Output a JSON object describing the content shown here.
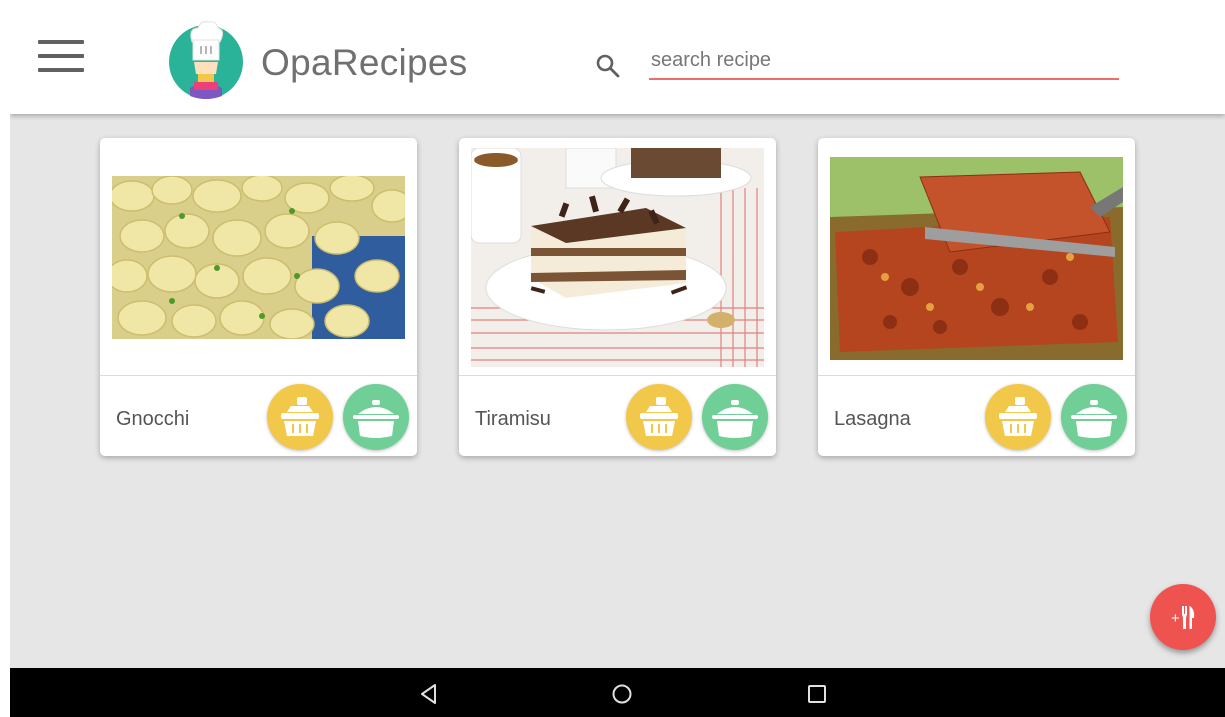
{
  "app": {
    "title": "OpaRecipes"
  },
  "header": {
    "menu_icon": "hamburger-menu-icon",
    "logo_icon": "chef-logo-icon",
    "search": {
      "placeholder": "search recipe",
      "value": "",
      "icon": "search-icon",
      "underline_color": "#ef6c6c"
    }
  },
  "recipes": [
    {
      "name": "Gnocchi",
      "image": "gnocchi-photo"
    },
    {
      "name": "Tiramisu",
      "image": "tiramisu-photo"
    },
    {
      "name": "Lasagna",
      "image": "lasagna-photo"
    }
  ],
  "card_actions": [
    {
      "icon": "shopping-basket-icon",
      "color": "#f2c84b"
    },
    {
      "icon": "cooking-pot-icon",
      "color": "#6fcf97"
    }
  ],
  "fab": {
    "icon": "add-cutlery-icon",
    "label": "+",
    "color": "#ef5350"
  },
  "nav": {
    "buttons": [
      "back-icon",
      "home-icon",
      "recents-icon"
    ]
  },
  "colors": {
    "background": "#e6e6e6",
    "appbar": "#ffffff",
    "navbar": "#000000"
  }
}
